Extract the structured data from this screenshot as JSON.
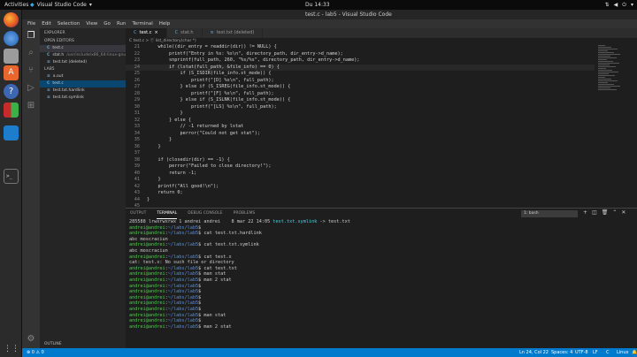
{
  "topbar": {
    "activities": "Activities",
    "app": "Visual Studio Code",
    "clock": "Du 14:33"
  },
  "window": {
    "title": "test.c - lab5 - Visual Studio Code"
  },
  "menu": [
    "File",
    "Edit",
    "Selection",
    "View",
    "Go",
    "Run",
    "Terminal",
    "Help"
  ],
  "sidebar": {
    "explorer": "EXPLORER",
    "open_editors": "OPEN EDITORS",
    "open": [
      {
        "icon": "C",
        "name": "test.c",
        "path": ""
      },
      {
        "icon": "C",
        "name": "stat.h",
        "path": "/usr/include/x86_64-linux-gnu..."
      },
      {
        "icon": "≡",
        "name": "test.txt (deleted)",
        "path": ""
      }
    ],
    "folder": "LAB5",
    "files": [
      {
        "icon": "≡",
        "name": "a.out"
      },
      {
        "icon": "C",
        "name": "test.c"
      },
      {
        "icon": "≡",
        "name": "test.txt.hardlink"
      },
      {
        "icon": "≡",
        "name": "test.txt.symlink"
      }
    ],
    "outline": "OUTLINE"
  },
  "tabs": [
    {
      "icon": "C",
      "label": "test.c",
      "active": true
    },
    {
      "icon": "C",
      "label": "stat.h",
      "active": false
    },
    {
      "icon": "≡",
      "label": "test.txt (deleted)",
      "active": false
    }
  ],
  "breadcrumb": "C test.c > ⓕ list_directory(char *)",
  "code": [
    {
      "n": "21",
      "t": "    while((dir_entry = readdir(dir)) != NULL) {"
    },
    {
      "n": "22",
      "t": "        printf(\"Entry in %s: %s\\n\", directory_path, dir_entry->d_name);"
    },
    {
      "n": "23",
      "t": "        snprintf(full_path, 260, \"%s/%s\", directory_path, dir_entry->d_name);"
    },
    {
      "n": "24",
      "t": "        if (lstat(full_path, &file_info) == 0) {"
    },
    {
      "n": "25",
      "t": "            if (S_ISDIR(file_info.st_mode)) {"
    },
    {
      "n": "26",
      "t": "                printf(\"[D] %s\\n\", full_path);"
    },
    {
      "n": "27",
      "t": "            } else if (S_ISREG(file_info.st_mode)) {"
    },
    {
      "n": "28",
      "t": "                printf(\"[F] %s\\n\", full_path);"
    },
    {
      "n": "29",
      "t": "            } else if (S_ISLNK(file_info.st_mode)) {"
    },
    {
      "n": "30",
      "t": "                printf(\"[LS] %s\\n\", full_path);"
    },
    {
      "n": "31",
      "t": "            }"
    },
    {
      "n": "32",
      "t": "        } else {"
    },
    {
      "n": "33",
      "t": "            // -1 returned by lstat"
    },
    {
      "n": "34",
      "t": "            perror(\"Could not get stat\");"
    },
    {
      "n": "35",
      "t": "        }"
    },
    {
      "n": "36",
      "t": "    }"
    },
    {
      "n": "37",
      "t": ""
    },
    {
      "n": "38",
      "t": "    if (closedir(dir) == -1) {"
    },
    {
      "n": "39",
      "t": "        perror(\"Failed to close directory!\");"
    },
    {
      "n": "40",
      "t": "        return -1;"
    },
    {
      "n": "41",
      "t": "    }"
    },
    {
      "n": "42",
      "t": "    printf(\"All good!\\n\");"
    },
    {
      "n": "43",
      "t": "    return 0;"
    },
    {
      "n": "44",
      "t": "}"
    },
    {
      "n": "45",
      "t": ""
    }
  ],
  "panel": {
    "tabs": [
      "OUTPUT",
      "TERMINAL",
      "DEBUG CONSOLE",
      "PROBLEMS"
    ],
    "active": "TERMINAL",
    "shell": "1: bash"
  },
  "terminal": [
    {
      "p": "",
      "d": "",
      "c": "285588 lrwxrwxrwx 1 andrei andrei    8 mar 22 14:05 ",
      "s": "test.txt.symlink",
      "r": " -> test.txt"
    },
    {
      "p": "andrei@andrei",
      "d": "~/labs/lab5",
      "c": "$ "
    },
    {
      "p": "andrei@andrei",
      "d": "~/labs/lab5",
      "c": "$ cat test.txt.hardlink"
    },
    {
      "p": "",
      "d": "",
      "c": "abc moscraciun"
    },
    {
      "p": "andrei@andrei",
      "d": "~/labs/lab5",
      "c": "$ cat test.txt.symlink"
    },
    {
      "p": "",
      "d": "",
      "c": "abc moscraciun"
    },
    {
      "p": "andrei@andrei",
      "d": "~/labs/lab5",
      "c": "$ cat test.x"
    },
    {
      "p": "",
      "d": "",
      "c": "cat: test.x: No such file or directory"
    },
    {
      "p": "andrei@andrei",
      "d": "~/labs/lab5",
      "c": "$ cat test.txt"
    },
    {
      "p": "andrei@andrei",
      "d": "~/labs/lab5",
      "c": "$ man stat"
    },
    {
      "p": "andrei@andrei",
      "d": "~/labs/lab5",
      "c": "$ man 2 stat"
    },
    {
      "p": "andrei@andrei",
      "d": "~/labs/lab5",
      "c": "$ "
    },
    {
      "p": "andrei@andrei",
      "d": "~/labs/lab5",
      "c": "$ "
    },
    {
      "p": "andrei@andrei",
      "d": "~/labs/lab5",
      "c": "$ "
    },
    {
      "p": "andrei@andrei",
      "d": "~/labs/lab5",
      "c": "$ "
    },
    {
      "p": "andrei@andrei",
      "d": "~/labs/lab5",
      "c": "$ "
    },
    {
      "p": "andrei@andrei",
      "d": "~/labs/lab5",
      "c": "$ man stat"
    },
    {
      "p": "andrei@andrei",
      "d": "~/labs/lab5",
      "c": "$ "
    },
    {
      "p": "andrei@andrei",
      "d": "~/labs/lab5",
      "c": "$ man 2 stat"
    }
  ],
  "status": {
    "errors": "⊗ 0 ⚠ 0",
    "position": "Ln 24, Col 22",
    "spaces": "Spaces: 4",
    "encoding": "UTF-8",
    "eol": "LF",
    "lang": "C",
    "os": "Linux"
  },
  "colors": {
    "accent": "#007acc",
    "prompt": "#4ec94e",
    "dir": "#5b8fd8"
  }
}
